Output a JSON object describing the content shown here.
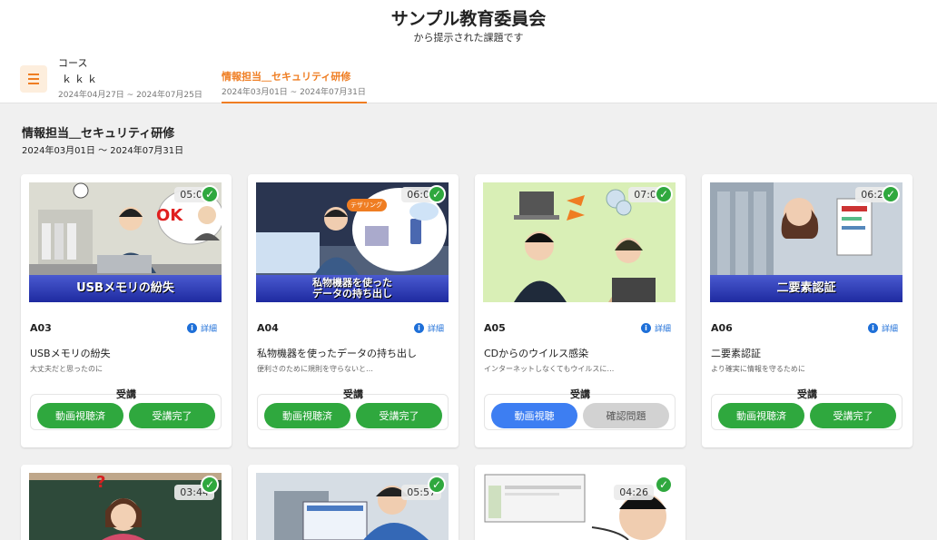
{
  "header": {
    "org_title": "サンプル教育委員会",
    "org_subtitle": "から提示された課題です",
    "tabs": [
      {
        "label": "コース",
        "label2": "ｋｋｋ",
        "dates": "2024年04月27日 ~ 2024年07月25日"
      },
      {
        "label": "情報担当＿セキュリティ研修",
        "dates": "2024年03月01日 ~ 2024年07月31日",
        "active": true
      }
    ]
  },
  "section": {
    "title": "情報担当＿セキュリティ研修",
    "dates": "2024年03月01日 〜 2024年07月31日"
  },
  "detail_label": "詳細",
  "attend_label": "受講",
  "cards": [
    {
      "code": "A03",
      "duration": "05:05",
      "banner": "USBメモリの紛失",
      "overlay_text": "OK",
      "title": "USBメモリの紛失",
      "subtitle": "大丈夫だと思ったのに",
      "btn1": "動画視聴済",
      "btn2": "受講完了",
      "state": "done"
    },
    {
      "code": "A04",
      "duration": "06:00",
      "banner": "私物機器を使った\nデータの持ち出し",
      "overlay_text": "テザリング",
      "title": "私物機器を使ったデータの持ち出し",
      "subtitle": "便利さのために規則を守らないと…",
      "btn1": "動画視聴済",
      "btn2": "受講完了",
      "state": "done"
    },
    {
      "code": "A05",
      "duration": "07:03",
      "banner": "",
      "title": "CDからのウイルス感染",
      "subtitle": "インターネットしなくてもウイルスに…",
      "btn1": "動画視聴",
      "btn2": "確認問題",
      "state": "pending"
    },
    {
      "code": "A06",
      "duration": "06:29",
      "banner": "二要素認証",
      "title": "二要素認証",
      "subtitle": "より確実に情報を守るために",
      "btn1": "動画視聴済",
      "btn2": "受講完了",
      "state": "done"
    },
    {
      "duration": "03:44",
      "overlay_text": "?"
    },
    {
      "duration": "05:57"
    },
    {
      "duration": "04:26"
    }
  ],
  "colors": {
    "accent": "#ef7d22",
    "green": "#2fa83e",
    "blue": "#3d7ef2",
    "link": "#1e6fd8"
  }
}
